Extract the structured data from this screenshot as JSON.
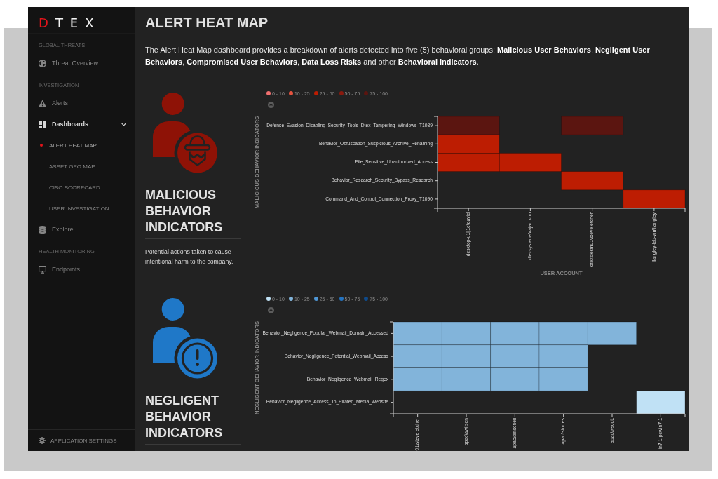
{
  "sidebar": {
    "logo": "DTEX",
    "sections": [
      {
        "heading": "GLOBAL THREATS",
        "items": [
          {
            "label": "Threat Overview",
            "selected": false
          }
        ]
      },
      {
        "heading": "INVESTIGATION",
        "items": [
          {
            "label": "Alerts",
            "selected": false
          },
          {
            "label": "Dashboards",
            "selected": false,
            "expanded": true,
            "children": [
              {
                "label": "ALERT HEAT MAP",
                "selected": true
              },
              {
                "label": "ASSET GEO MAP",
                "selected": false
              },
              {
                "label": "CISO SCORECARD",
                "selected": false
              },
              {
                "label": "USER INVESTIGATION",
                "selected": false
              }
            ]
          },
          {
            "label": "Explore",
            "selected": false
          }
        ]
      },
      {
        "heading": "HEALTH MONITORING",
        "items": [
          {
            "label": "Endpoints",
            "selected": false
          }
        ]
      }
    ],
    "settings": "APPLICATION SETTINGS"
  },
  "page": {
    "title": "ALERT HEAT MAP",
    "description": "The Alert Heat Map dashboard provides a breakdown of alerts detected into five (5) behavioral groups: **Malicious User Behaviors**, **Negligent User Behaviors**, **Compromised User Behaviors**, **Data Loss Risks** and other **Behavioral Indicators**."
  },
  "sections": [
    {
      "kind": "malicious",
      "title": "MALICIOUS BEHAVIOR INDICATORS",
      "description": "Potential actions taken to cause intentional harm to the company.",
      "heatmap": {
        "legend": [
          {
            "label": "0 - 10",
            "color": "#f07070"
          },
          {
            "label": "10 - 25",
            "color": "#e5533f"
          },
          {
            "label": "25 - 50",
            "color": "#bd1d02"
          },
          {
            "label": "50 - 75",
            "color": "#8a1a0e"
          },
          {
            "label": "75 - 100",
            "color": "#5b1510"
          }
        ],
        "y_title": "MALICIOUS BEHAVIOR INDICATORS",
        "x_title": "USER ACCOUNT",
        "columns": [
          "desktop-u1lj1e\\david",
          "dtexsystems\\rajan.koo",
          "dtexsiesm01\\steve etcher",
          "llangley-lab-vm\\llangley"
        ],
        "rows": [
          {
            "label": "Defense_Evasion_Disabling_Security_Tools_Dtex_Tampering_Windows_T1089",
            "cells": [
              {
                "filled": true,
                "color": "#5b1510"
              },
              {
                "filled": false
              },
              {
                "filled": true,
                "color": "#5b1510"
              },
              {
                "filled": false
              }
            ]
          },
          {
            "label": "Behavior_Obfuscation_Suspicious_Archive_Renaming",
            "cells": [
              {
                "filled": true,
                "color": "#bd1d02"
              },
              {
                "filled": false
              },
              {
                "filled": false
              },
              {
                "filled": false
              }
            ]
          },
          {
            "label": "File_Sensitive_Unauthorized_Access",
            "cells": [
              {
                "filled": true,
                "color": "#bd1d02"
              },
              {
                "filled": true,
                "color": "#bd1d02"
              },
              {
                "filled": false
              },
              {
                "filled": false
              }
            ]
          },
          {
            "label": "Behavior_Research_Security_Bypass_Research",
            "cells": [
              {
                "filled": false
              },
              {
                "filled": false
              },
              {
                "filled": true,
                "color": "#bd1d02"
              },
              {
                "filled": false
              }
            ]
          },
          {
            "label": "Command_And_Control_Connection_Proxy_T1090",
            "cells": [
              {
                "filled": false
              },
              {
                "filled": false
              },
              {
                "filled": false
              },
              {
                "filled": true,
                "color": "#bd1d02"
              }
            ]
          }
        ]
      }
    },
    {
      "kind": "negligent",
      "title": "NEGLIGENT BEHAVIOR INDICATORS",
      "heatmap": {
        "legend": [
          {
            "label": "0 - 10",
            "color": "#c0e1f5"
          },
          {
            "label": "10 - 25",
            "color": "#82b4da"
          },
          {
            "label": "25 - 50",
            "color": "#4f97d6"
          },
          {
            "label": "50 - 75",
            "color": "#2473c0"
          },
          {
            "label": "75 - 100",
            "color": "#0f4a8a"
          }
        ],
        "y_title": "NEGLIGENT BEHAVIOR INDICATORS",
        "columns": [
          "01\\steve etcher",
          "apac\\awilson",
          "apac\\dmitchell",
          "apac\\storres",
          "apac\\wscott",
          "in7-1-pcwin7-1"
        ],
        "rows": [
          {
            "label": "Behavior_Negligence_Popular_Webmail_Domain_Accessed",
            "cells": [
              {
                "filled": true,
                "color": "#82b4da"
              },
              {
                "filled": true,
                "color": "#82b4da"
              },
              {
                "filled": true,
                "color": "#82b4da"
              },
              {
                "filled": true,
                "color": "#82b4da"
              },
              {
                "filled": true,
                "color": "#82b4da"
              },
              {
                "filled": false
              }
            ]
          },
          {
            "label": "Behavior_Negligence_Potential_Webmail_Access",
            "cells": [
              {
                "filled": true,
                "color": "#82b4da"
              },
              {
                "filled": true,
                "color": "#82b4da"
              },
              {
                "filled": true,
                "color": "#82b4da"
              },
              {
                "filled": true,
                "color": "#82b4da"
              },
              {
                "filled": false
              },
              {
                "filled": false
              }
            ]
          },
          {
            "label": "Behavior_Negligence_Webmail_Regex",
            "cells": [
              {
                "filled": true,
                "color": "#82b4da"
              },
              {
                "filled": true,
                "color": "#82b4da"
              },
              {
                "filled": true,
                "color": "#82b4da"
              },
              {
                "filled": true,
                "color": "#82b4da"
              },
              {
                "filled": false
              },
              {
                "filled": false
              }
            ]
          },
          {
            "label": "Behavior_Negligence_Access_To_Pirated_Media_Website",
            "cells": [
              {
                "filled": false
              },
              {
                "filled": false
              },
              {
                "filled": false
              },
              {
                "filled": false
              },
              {
                "filled": false
              },
              {
                "filled": true,
                "color": "#c0e1f5"
              }
            ]
          }
        ]
      }
    }
  ]
}
